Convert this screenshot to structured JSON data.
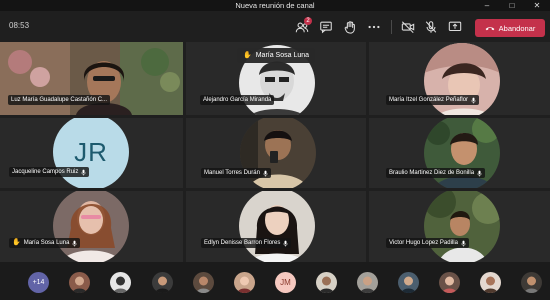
{
  "window": {
    "title": "Nueva reunión de canal"
  },
  "toolbar": {
    "clock": "08:53",
    "participants_badge": "2",
    "leave_label": "Abandonar",
    "leave_color": "#c4314b"
  },
  "raised_hand_banner": {
    "name": "María Sosa Luna"
  },
  "tiles": [
    {
      "name": "Luz María Guadalupe Castañón C..."
    },
    {
      "name": "Alejandro García Miranda"
    },
    {
      "name": "María Itzel González Peñaflor"
    },
    {
      "name": "Jacqueline Campos Ruiz",
      "initials": "JR"
    },
    {
      "name": "Manuel Torres Durán"
    },
    {
      "name": "Braulio Martinez Diez de Bonilla"
    },
    {
      "name": "María Sosa Luna"
    },
    {
      "name": "Edlyn Denisse Barron Flores"
    },
    {
      "name": "Victor Hugo Lopez Padilla"
    }
  ],
  "strip": {
    "more_count": "+14",
    "initials_jm": "JM"
  },
  "icons": [
    "participants-icon",
    "chat-icon",
    "raise-hand-icon",
    "more-icon",
    "camera-off-icon",
    "mic-off-icon",
    "share-icon",
    "phone-icon"
  ]
}
